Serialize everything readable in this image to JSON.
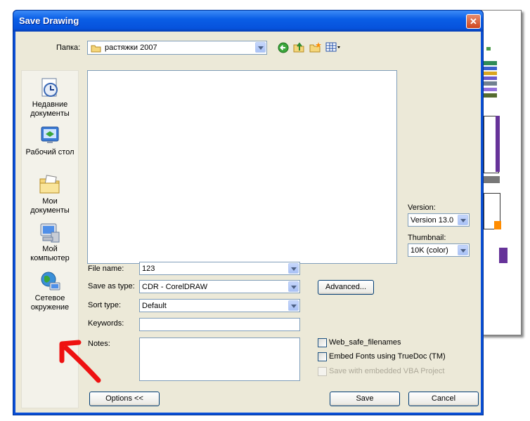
{
  "window": {
    "title": "Save Drawing"
  },
  "lookin": {
    "label": "Папка:",
    "value": "растяжки 2007"
  },
  "places": [
    {
      "label": "Недавние документы",
      "icon": "recent-documents-icon"
    },
    {
      "label": "Рабочий стол",
      "icon": "desktop-icon"
    },
    {
      "label": "Мои документы",
      "icon": "my-documents-icon"
    },
    {
      "label": "Мой компьютер",
      "icon": "my-computer-icon"
    },
    {
      "label": "Сетевое окружение",
      "icon": "network-places-icon"
    }
  ],
  "version": {
    "label": "Version:",
    "value": "Version 13.0"
  },
  "thumbnail": {
    "label": "Thumbnail:",
    "value": "10K (color)"
  },
  "filename": {
    "label": "File name:",
    "value": "123"
  },
  "saveastype": {
    "label": "Save as type:",
    "value": "CDR - CorelDRAW"
  },
  "sorttype": {
    "label": "Sort type:",
    "value": "Default"
  },
  "keywords": {
    "label": "Keywords:",
    "value": ""
  },
  "notes": {
    "label": "Notes:",
    "value": ""
  },
  "buttons": {
    "advanced": "Advanced...",
    "options": "Options <<",
    "save": "Save",
    "cancel": "Cancel"
  },
  "checkboxes": [
    {
      "label": "Web_safe_filenames",
      "checked": false,
      "enabled": true
    },
    {
      "label": "Embed Fonts using TrueDoc (TM)",
      "checked": false,
      "enabled": true
    },
    {
      "label": "Save with embedded VBA Project",
      "checked": false,
      "enabled": false
    }
  ],
  "colors": {
    "titlebar": "#0a5ee6",
    "dialog": "#ece9d8",
    "annotation_arrow": "#ee1111"
  }
}
